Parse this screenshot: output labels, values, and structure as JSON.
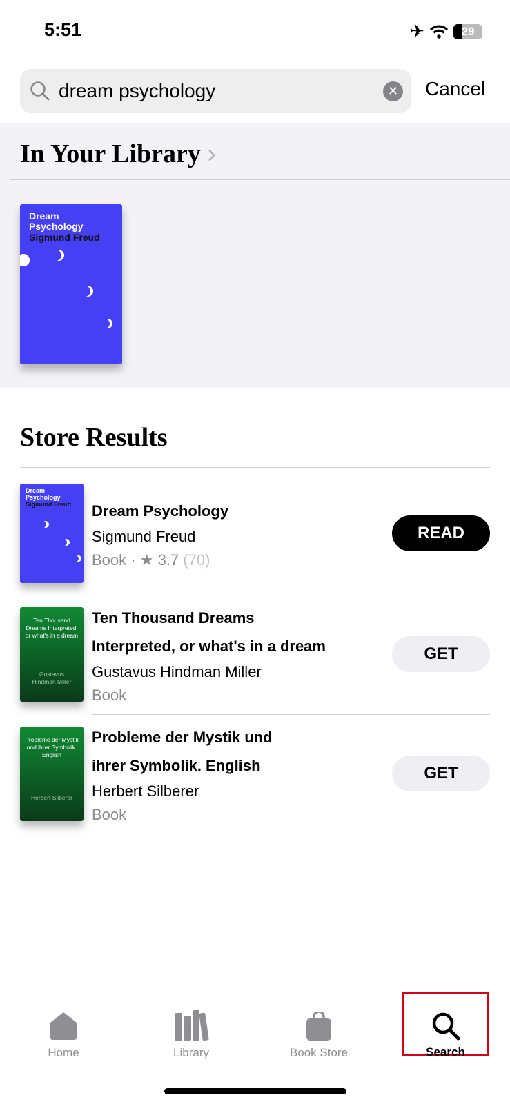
{
  "status_bar": {
    "time": "5:51",
    "battery": "29",
    "icons": [
      "airplane-icon",
      "wifi-icon",
      "battery-icon"
    ]
  },
  "search": {
    "value": "dream psychology",
    "cancel_label": "Cancel"
  },
  "library": {
    "heading": "In Your Library",
    "items": [
      {
        "cover_title": "Dream Psychology",
        "cover_author": "Sigmund Freud"
      }
    ]
  },
  "store": {
    "heading": "Store Results",
    "results": [
      {
        "title": "Dream Psychology",
        "author": "Sigmund Freud",
        "type": "Book",
        "rating": "3.7",
        "rating_count": "(70)",
        "action": "READ",
        "cover_title": "Dream Psychology",
        "cover_author": "Sigmund Freud"
      },
      {
        "title_line1": "Ten Thousand Dreams",
        "title_line2": "Interpreted, or what's in a dream",
        "author": "Gustavus Hindman Miller",
        "type": "Book",
        "action": "GET",
        "cover_title": "Ten Thousand Dreams Interpreted, or what's in a dream",
        "cover_author": "Gustavus Hindman Miller"
      },
      {
        "title_line1": "Probleme der Mystik und",
        "title_line2": "ihrer Symbolik. English",
        "author": "Herbert Silberer",
        "type": "Book",
        "action": "GET",
        "cover_title": "Probleme der Mystik und ihrer Symbolik. English",
        "cover_author": "Herbert Silberer"
      }
    ]
  },
  "tab_bar": {
    "active": "Search",
    "items": [
      {
        "label": "Home",
        "icon": "home-icon"
      },
      {
        "label": "Library",
        "icon": "library-icon"
      },
      {
        "label": "Book Store",
        "icon": "bag-icon"
      },
      {
        "label": "Search",
        "icon": "search-icon"
      }
    ]
  },
  "colors": {
    "highlight": "#d0021b",
    "blue_cover": "#4640f5",
    "green_cover": "#108a34"
  }
}
